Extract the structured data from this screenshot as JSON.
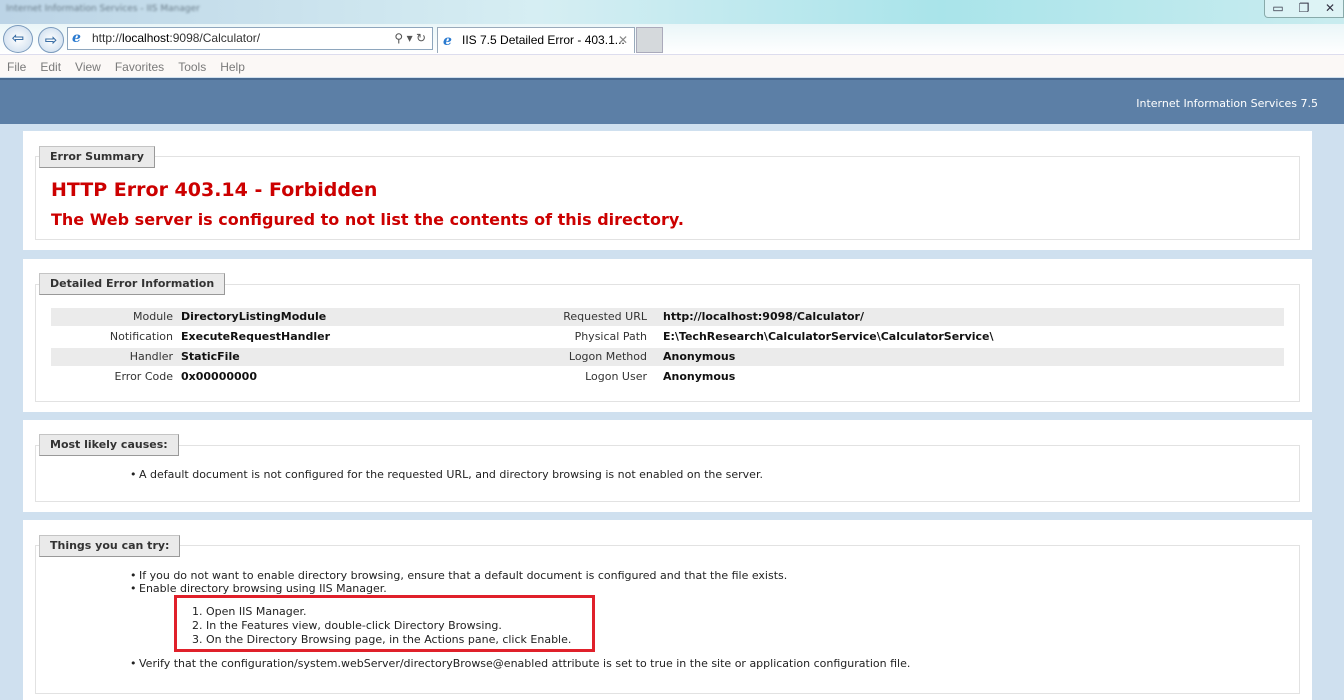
{
  "browser": {
    "window_title": "Internet Information Services - IIS Manager",
    "url_prefix": "http://",
    "url_host": "localhost",
    "url_rest": ":9098/Calculator/",
    "tab_title": "IIS 7.5 Detailed Error - 403.1...",
    "menu": [
      "File",
      "Edit",
      "View",
      "Favorites",
      "Tools",
      "Help"
    ]
  },
  "header": {
    "product": "Internet Information Services 7.5"
  },
  "summary": {
    "legend": "Error Summary",
    "title": "HTTP Error 403.14 - Forbidden",
    "subtitle": "The Web server is configured to not list the contents of this directory."
  },
  "details": {
    "legend": "Detailed Error Information",
    "left": [
      {
        "label": "Module",
        "value": "DirectoryListingModule"
      },
      {
        "label": "Notification",
        "value": "ExecuteRequestHandler"
      },
      {
        "label": "Handler",
        "value": "StaticFile"
      },
      {
        "label": "Error Code",
        "value": "0x00000000"
      }
    ],
    "right": [
      {
        "label": "Requested URL",
        "value": "http://localhost:9098/Calculator/"
      },
      {
        "label": "Physical Path",
        "value": "E:\\TechResearch\\CalculatorService\\CalculatorService\\"
      },
      {
        "label": "Logon Method",
        "value": "Anonymous"
      },
      {
        "label": "Logon User",
        "value": "Anonymous"
      }
    ]
  },
  "causes": {
    "legend": "Most likely causes:",
    "items": [
      "A default document is not configured for the requested URL, and directory browsing is not enabled on the server."
    ]
  },
  "try": {
    "legend": "Things you can try:",
    "items": [
      "If you do not want to enable directory browsing, ensure that a default document is configured and that the file exists.",
      "Enable directory browsing using IIS Manager.",
      "Verify that the configuration/system.webServer/directoryBrowse@enabled attribute is set to true in the site or application configuration file."
    ],
    "steps": [
      "1.  Open IIS Manager.",
      "2.  In the Features view, double-click Directory Browsing.",
      "3.  On the Directory Browsing page, in the Actions pane, click Enable."
    ]
  },
  "colors": {
    "header": "#5c7fa6",
    "error": "#cc0000",
    "highlight": "#e0202a"
  }
}
